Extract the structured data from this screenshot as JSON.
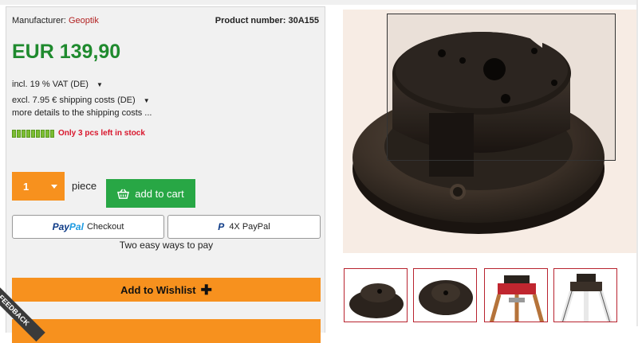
{
  "product": {
    "manufacturer_label": "Manufacturer:",
    "manufacturer_name": "Geoptik",
    "product_number_label": "Product number: 30A155",
    "price": "EUR 139,90",
    "vat": "incl. 19 % VAT (DE)",
    "shipping": "excl. 7.95 € shipping costs (DE)",
    "shipping_link": "more details to the shipping costs ...",
    "stock": "Only 3 pcs left in stock"
  },
  "buy": {
    "qty": "1",
    "unit": "piece",
    "add_to_cart": "add to cart"
  },
  "paypal": {
    "checkout_pay": "Pay",
    "checkout_pal": "Pal",
    "checkout_label": "Checkout",
    "installments_label": "4X PayPal",
    "easy_ways": "Two easy ways to pay"
  },
  "wishlist": {
    "label": "Add to Wishlist"
  },
  "feedback": {
    "label": "FEEDBACK"
  },
  "colors": {
    "price_green": "#1f8a2e",
    "cart_green": "#28a745",
    "orange": "#f7911e",
    "stock_red": "#d9162c"
  }
}
